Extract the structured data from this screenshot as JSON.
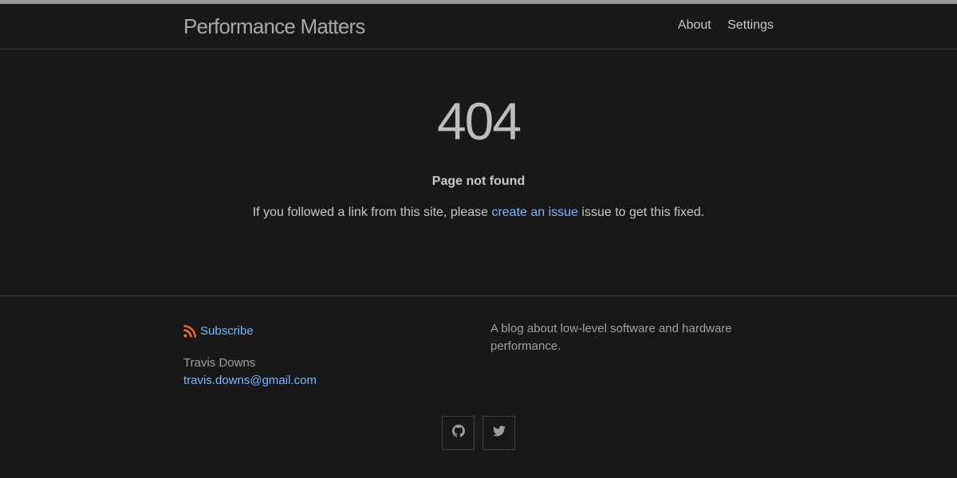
{
  "header": {
    "site_title": "Performance Matters",
    "nav": [
      "About",
      "Settings"
    ]
  },
  "main": {
    "code": "404",
    "subtitle": "Page not found",
    "message_before": "If you followed a link from this site, please ",
    "message_link": "create an issue",
    "message_after": " issue to get this fixed."
  },
  "footer": {
    "subscribe_label": "Subscribe",
    "author_name": "Travis Downs",
    "author_email": "travis.downs@gmail.com",
    "description": "A blog about low-level software and hardware performance.",
    "social_icons": [
      "github-icon",
      "twitter-icon"
    ]
  },
  "colors": {
    "background": "#181818",
    "link": "#79b8ff",
    "rss": "#e8741e",
    "top_bar": "#9a9a9a"
  }
}
